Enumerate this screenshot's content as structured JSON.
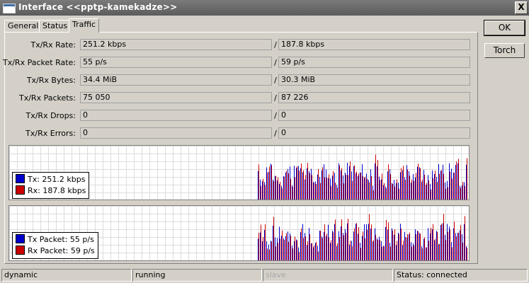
{
  "window": {
    "title": "Interface <<pptp-kamekadze>>",
    "close_label": "X"
  },
  "tabs": [
    {
      "label": "General"
    },
    {
      "label": "Status"
    },
    {
      "label": "Traffic"
    }
  ],
  "active_tab": "Traffic",
  "buttons": {
    "ok": "OK",
    "torch": "Torch"
  },
  "stats": [
    {
      "label": "Tx/Rx Rate:",
      "tx": "251.2 kbps",
      "rx": "187.8 kbps"
    },
    {
      "label": "Tx/Rx Packet Rate:",
      "tx": "55 p/s",
      "rx": "59 p/s"
    },
    {
      "label": "Tx/Rx Bytes:",
      "tx": "34.4 MiB",
      "rx": "30.3 MiB"
    },
    {
      "label": "Tx/Rx Packets:",
      "tx": "75 050",
      "rx": "87 226"
    },
    {
      "label": "Tx/Rx Drops:",
      "tx": "0",
      "rx": "0"
    },
    {
      "label": "Tx/Rx Errors:",
      "tx": "0",
      "rx": "0"
    }
  ],
  "separator": "/",
  "colors": {
    "tx": "#0000cc",
    "rx": "#cc0000",
    "grid": "#dcdcdc"
  },
  "graphs": {
    "rate": {
      "legend": [
        {
          "label": "Tx:  251.2 kbps",
          "color": "#0000cc"
        },
        {
          "label": "Rx:  187.8 kbps",
          "color": "#cc0000"
        }
      ]
    },
    "packets": {
      "legend": [
        {
          "label": "Tx Packet:  55 p/s",
          "color": "#0000cc"
        },
        {
          "label": "Rx Packet:  59 p/s",
          "color": "#cc0000"
        }
      ]
    }
  },
  "statusbar": {
    "s1": "dynamic",
    "s2": "running",
    "s3": "slave",
    "s4": "Status: connected"
  }
}
